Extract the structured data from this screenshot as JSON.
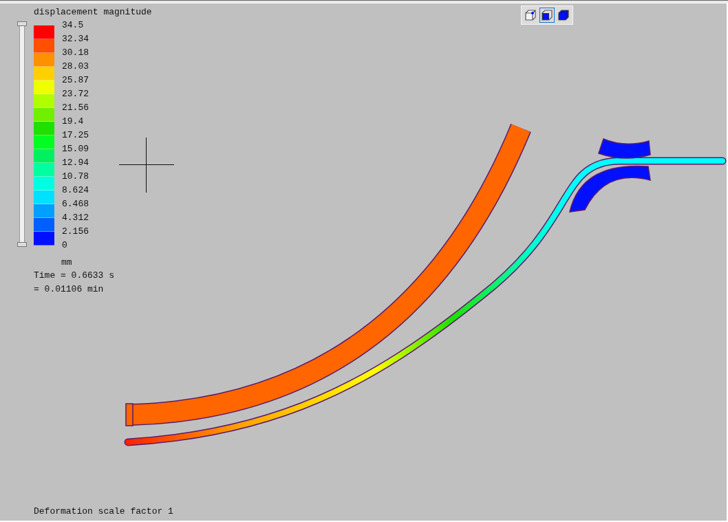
{
  "legend": {
    "title": "displacement magnitude",
    "bands": [
      {
        "color": "#ff0000"
      },
      {
        "color": "#ff5000"
      },
      {
        "color": "#ff9000"
      },
      {
        "color": "#ffd000"
      },
      {
        "color": "#f0ff00"
      },
      {
        "color": "#b0ff00"
      },
      {
        "color": "#70f000"
      },
      {
        "color": "#20e000"
      },
      {
        "color": "#00ff20"
      },
      {
        "color": "#00f060"
      },
      {
        "color": "#00ffa0"
      },
      {
        "color": "#00ffe0"
      },
      {
        "color": "#00e0ff"
      },
      {
        "color": "#00a0ff"
      },
      {
        "color": "#0060ff"
      },
      {
        "color": "#0010ff"
      }
    ],
    "labels": [
      "34.5",
      "32.34",
      "30.18",
      "28.03",
      "25.87",
      "23.72",
      "21.56",
      "19.4",
      "17.25",
      "15.09",
      "12.94",
      "10.78",
      "8.624",
      "6.468",
      "4.312",
      "2.156",
      "0"
    ],
    "unit": "mm",
    "range_slider": {
      "level": 1
    }
  },
  "time": [
    "Time = 0.6633 s",
    "= 0.01106 min"
  ],
  "view_modes": [
    {
      "kind": "wireframe",
      "selected": false
    },
    {
      "kind": "shaded-edges",
      "selected": true
    },
    {
      "kind": "shaded",
      "selected": false
    }
  ],
  "status": "Deformation scale factor 1"
}
